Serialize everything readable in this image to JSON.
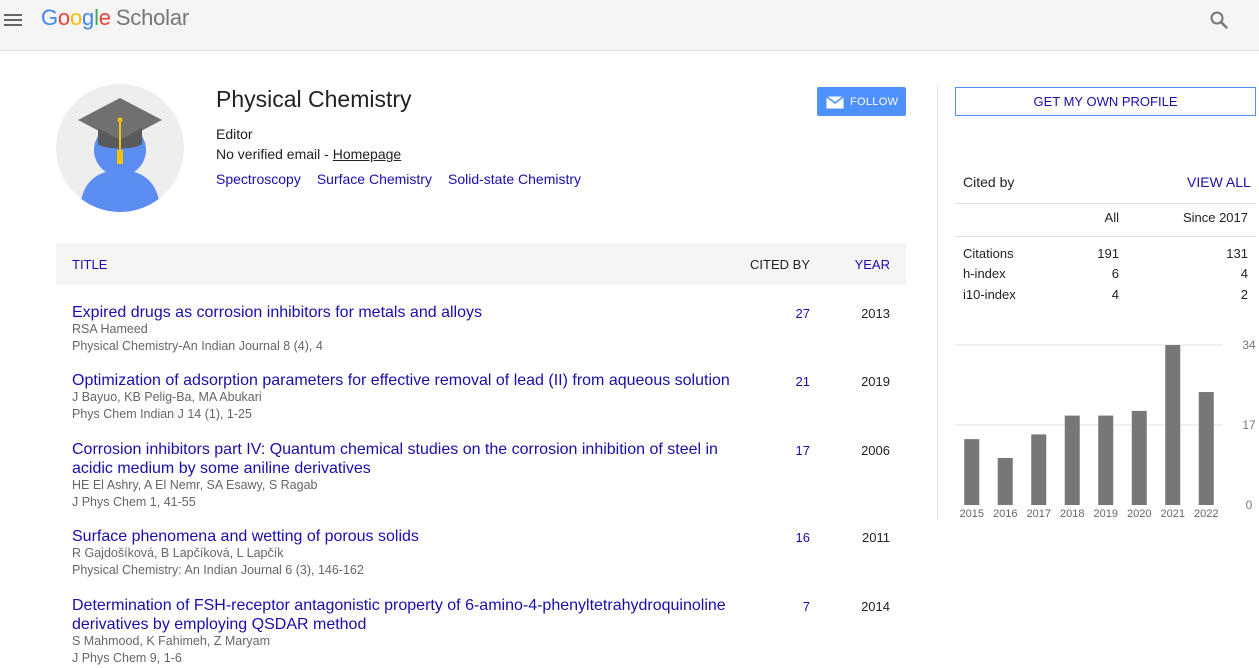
{
  "header": {
    "logo_letters": [
      {
        "ch": "G",
        "color": "#4285f4"
      },
      {
        "ch": "o",
        "color": "#ea4335"
      },
      {
        "ch": "o",
        "color": "#fbbc05"
      },
      {
        "ch": "g",
        "color": "#4285f4"
      },
      {
        "ch": "l",
        "color": "#34a853"
      },
      {
        "ch": "e",
        "color": "#ea4335"
      }
    ],
    "logo_product": "Scholar"
  },
  "profile": {
    "name": "Physical Chemistry",
    "affiliation": "Editor",
    "email_text": "No verified email - ",
    "homepage_label": "Homepage",
    "interests": [
      "Spectroscopy",
      "Surface Chemistry",
      "Solid-state Chemistry"
    ],
    "follow_label": "FOLLOW"
  },
  "table": {
    "header": {
      "title": "TITLE",
      "cited_by": "CITED BY",
      "year": "YEAR"
    },
    "rows": [
      {
        "title": "Expired drugs as corrosion inhibitors for metals and alloys",
        "authors": "RSA Hameed",
        "venue": "Physical Chemistry-An Indian Journal 8 (4), 4",
        "cited": "27",
        "year": "2013"
      },
      {
        "title": "Optimization of adsorption parameters for effective removal of lead (II) from aqueous solution",
        "authors": "J Bayuo, KB Pelig-Ba, MA Abukari",
        "venue": "Phys Chem Indian J 14 (1), 1-25",
        "cited": "21",
        "year": "2019"
      },
      {
        "title": "Corrosion inhibitors part IV: Quantum chemical studies on the corrosion inhibition of steel in acidic medium by some aniline derivatives",
        "authors": "HE El Ashry, A El Nemr, SA Esawy, S Ragab",
        "venue": "J Phys Chem 1, 41-55",
        "cited": "17",
        "year": "2006"
      },
      {
        "title": "Surface phenomena and wetting of porous solids",
        "authors": "R Gajdošíková, B Lapčíková, L Lapčík",
        "venue": "Physical Chemistry: An Indian Journal 6 (3), 146-162",
        "cited": "16",
        "year": "2011"
      },
      {
        "title": "Determination of FSH-receptor antagonistic property of 6-amino-4-phenyltetrahydroquinoline derivatives by employing QSDAR method",
        "authors": "S Mahmood, K Fahimeh, Z Maryam",
        "venue": "J Phys Chem 9, 1-6",
        "cited": "7",
        "year": "2014"
      }
    ]
  },
  "sidebar": {
    "get_profile_label": "GET MY OWN PROFILE",
    "cited_by_label": "Cited by",
    "view_all_label": "VIEW ALL",
    "stats_header": {
      "all": "All",
      "since": "Since 2017"
    },
    "stats": [
      {
        "label": "Citations",
        "all": "191",
        "since": "131"
      },
      {
        "label": "h-index",
        "all": "6",
        "since": "4"
      },
      {
        "label": "i10-index",
        "all": "4",
        "since": "2"
      }
    ]
  },
  "chart_data": {
    "type": "bar",
    "categories": [
      "2015",
      "2016",
      "2017",
      "2018",
      "2019",
      "2020",
      "2021",
      "2022"
    ],
    "values": [
      14,
      10,
      15,
      19,
      19,
      20,
      34,
      24
    ],
    "y_ticks": [
      "34",
      "17",
      "0"
    ],
    "ylim": [
      0,
      34
    ],
    "bar_color": "#777777"
  }
}
